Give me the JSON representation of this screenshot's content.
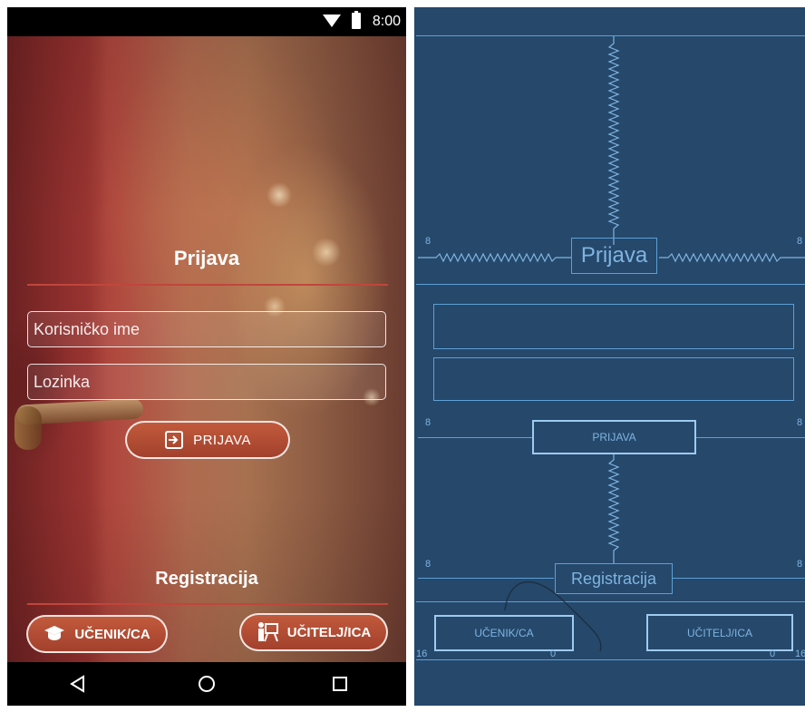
{
  "status_bar": {
    "time": "8:00"
  },
  "login": {
    "title": "Prijava",
    "username_placeholder": "Korisničko ime",
    "password_placeholder": "Lozinka",
    "login_button": "PRIJAVA"
  },
  "registration": {
    "title": "Registracija",
    "student_button": "UČENIK/CA",
    "teacher_button": "UČITELJ/ICA"
  },
  "blueprint": {
    "title": "Prijava",
    "login_button": "PRIJAVA",
    "registration": "Registracija",
    "student_button": "UČENIK/CA",
    "teacher_button": "UČITELJ/ICA",
    "margin_8": "8",
    "margin_16": "16",
    "margin_0": "0"
  },
  "colors": {
    "accent": "#a2412d",
    "divider": "#c0463c",
    "blueprint_bg": "#25486b",
    "blueprint_line": "#5ea0d6"
  }
}
